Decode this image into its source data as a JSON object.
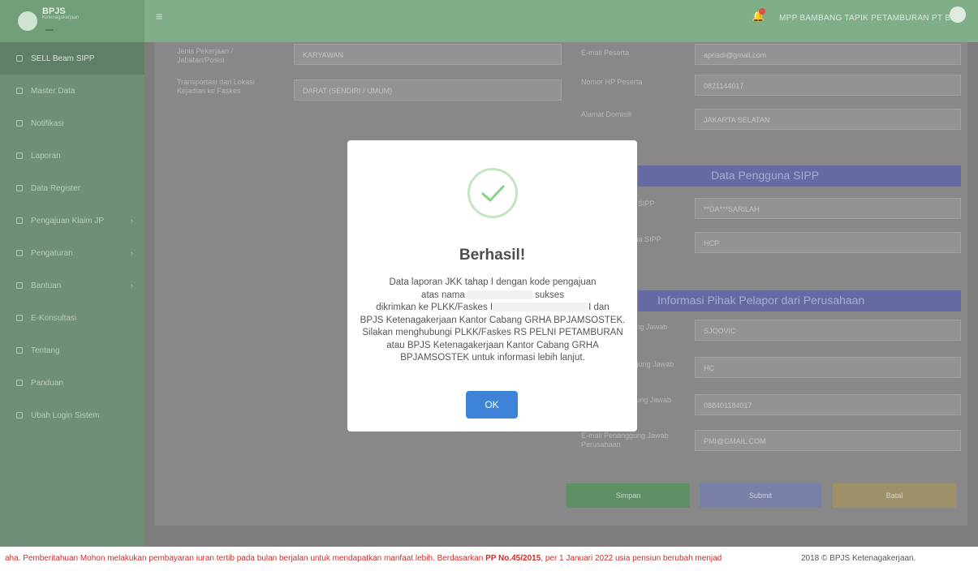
{
  "header": {
    "brand_title": "BPJS",
    "brand_subtitle": "Ketenagakerjaan",
    "brand_badge": "",
    "user_name": "MPP BAMBANG TAPIK PETAMBURAN PT BAM"
  },
  "sidebar": {
    "items": [
      {
        "label": "SELL Beam SIPP",
        "active": true
      },
      {
        "label": "Master Data"
      },
      {
        "label": "Notifikasi"
      },
      {
        "label": "Laporan"
      },
      {
        "label": "Data Register"
      },
      {
        "label": "Pengajuan Klaim JP",
        "caret": "›"
      },
      {
        "label": "Pengaturan",
        "caret": "›"
      },
      {
        "label": "Bantuan",
        "caret": "›"
      },
      {
        "label": "E-Konsultasi"
      },
      {
        "label": "Tentang"
      },
      {
        "label": "Panduan"
      },
      {
        "label": "Ubah Login Sistem"
      }
    ]
  },
  "form": {
    "jenis_label": "Jenis Pekerjaan / Jabatan/Posisi",
    "jenis_value": "KARYAWAN",
    "transport_label": "Transportasi dari Lokasi Kejadian ke Faskes",
    "transport_value": "DARAT (SENDIRI / UMUM)",
    "email_label": "E-mail Peserta",
    "email_value": "apriadi@gmail.com",
    "hp_label": "Nomor HP Peserta",
    "hp_value": "0821144017",
    "alamat_label": "Alamat Domisili",
    "alamat_value": "JAKARTA SELATAN",
    "section_sipp": "Data Pengguna SIPP",
    "sipp_name_label": "Nama Pengguna SIPP",
    "sipp_name_value": "**DA***SARILAH",
    "sipp_jabatan_label": "Jabatan Pengguna SIPP",
    "sipp_jabatan_value": "HCP",
    "section_pj": "Informasi Pihak Pelapor dari Perusahaan",
    "pj_name_label": "Nama Penanggung Jawab",
    "pj_name_value": "SJOOVIC",
    "pj_jabatan_label": "Jabatan Penanggung Jawab",
    "pj_jabatan_value": "HC",
    "pj_hp_label": "No. HP Penanggung Jawab Perusahaan",
    "pj_hp_value": "088401184017",
    "pj_email_label": "E-mail Penanggung Jawab Perusahaan",
    "pj_email_value": "PMI@GMAIL.COM",
    "btn_simpan": "Simpan",
    "btn_submit": "Submit",
    "btn_batal": "Batal"
  },
  "footer": {
    "marquee_start": "aha. Pemberitahuan Mohon melakukan pembayaran iuran tertib pada bulan berjalan untuk mendapatkan manfaat lebih. Berdasarkan ",
    "marquee_bold": "PP No.45/2015",
    "marquee_end": ", per 1 Januari 2022 usia pensiun berubah menjad",
    "copyright": "2018 © BPJS Ketenagakerjaan."
  },
  "modal": {
    "title": "Berhasil!",
    "line1": "Data laporan JKK tahap I dengan kode pengajuan",
    "line2a": "atas nama",
    "line2b": "sukses",
    "line3a": "dikrimkan ke PLKK/Faskes I",
    "line3b": "I dan",
    "line4": "BPJS Ketenagakerjaan Kantor Cabang GRHA BPJAMSOSTEK. Silakan menghubungi PLKK/Faskes RS PELNI PETAMBURAN atau BPJS Ketenagakerjaan Kantor Cabang GRHA BPJAMSOSTEK untuk informasi lebih lanjut.",
    "ok_label": "OK"
  },
  "colors": {
    "success": "#8ccf8a",
    "ok_button": "#3d84d8",
    "marquee": "#c9302c"
  }
}
